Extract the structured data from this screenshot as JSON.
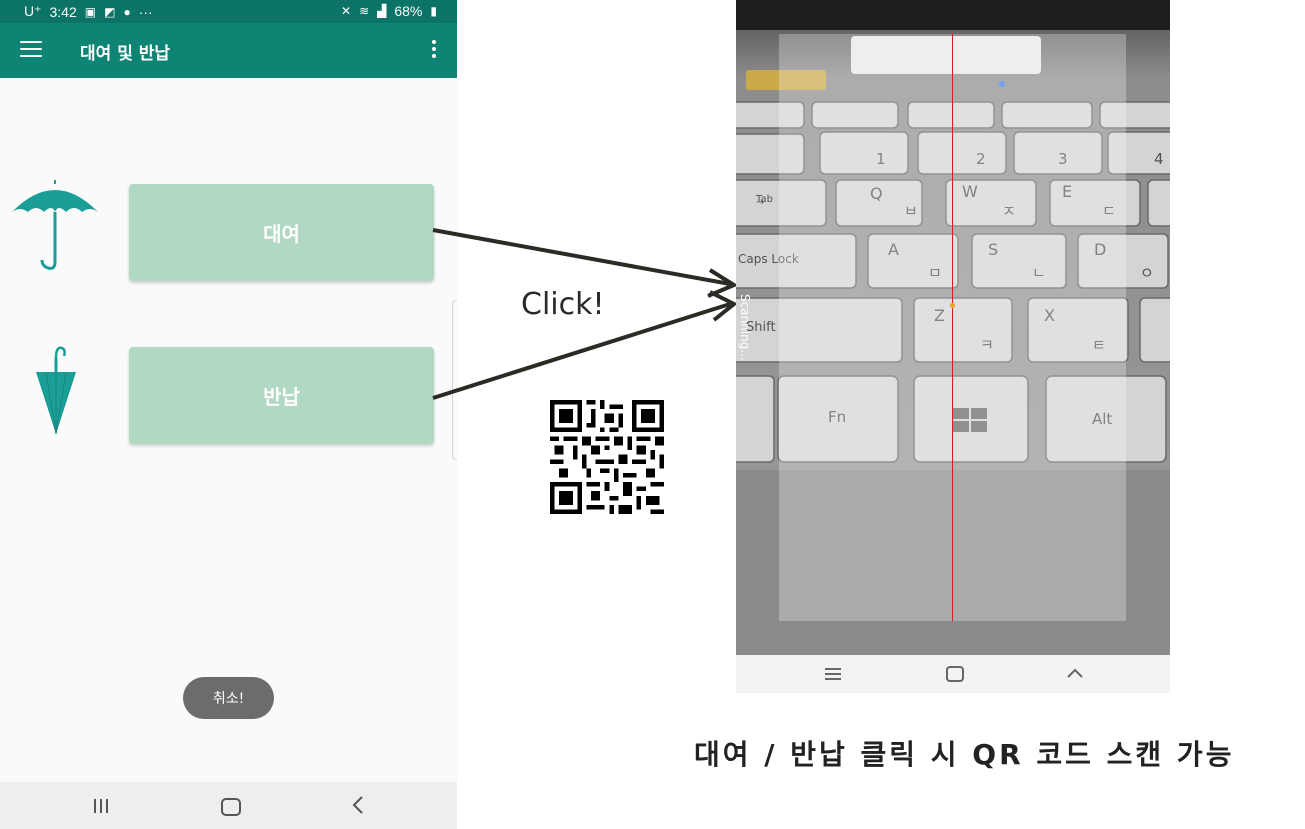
{
  "status_bar": {
    "carrier": "U⁺",
    "time": "3:42",
    "more": "···",
    "battery": "68%"
  },
  "app_bar": {
    "title": "대여 및 반납"
  },
  "buttons": {
    "rent_label": "대여",
    "return_label": "반납"
  },
  "toast": {
    "text": "취소!"
  },
  "annotation": {
    "click_label": "Click!"
  },
  "scanner": {
    "scanning_text": "Scanning...",
    "keys": {
      "tab": "Tab",
      "caps": "Caps Lock",
      "shift": "Shift",
      "fn": "Fn",
      "alt": "Alt",
      "q": "Q",
      "q_kr": "ㅂ",
      "w": "W",
      "w_kr": "ㅈ",
      "e": "E",
      "e_kr": "ㄷ",
      "a": "A",
      "a_kr": "ㅁ",
      "s": "S",
      "s_kr": "ㄴ",
      "d": "D",
      "d_kr": "ㅇ",
      "z": "Z",
      "z_kr": "ㅋ",
      "x": "X",
      "x_kr": "ㅌ",
      "n1": "1",
      "n2": "2",
      "n3": "3",
      "n4": "4"
    }
  },
  "caption": "대여 / 반납 클릭 시 QR 코드 스캔 가능",
  "colors": {
    "status_bar": "#0c7466",
    "app_bar": "#0e8574",
    "button_bg": "#b0d8c2",
    "umbrella": "#1a9e96",
    "scan_line": "#d21f1f"
  }
}
